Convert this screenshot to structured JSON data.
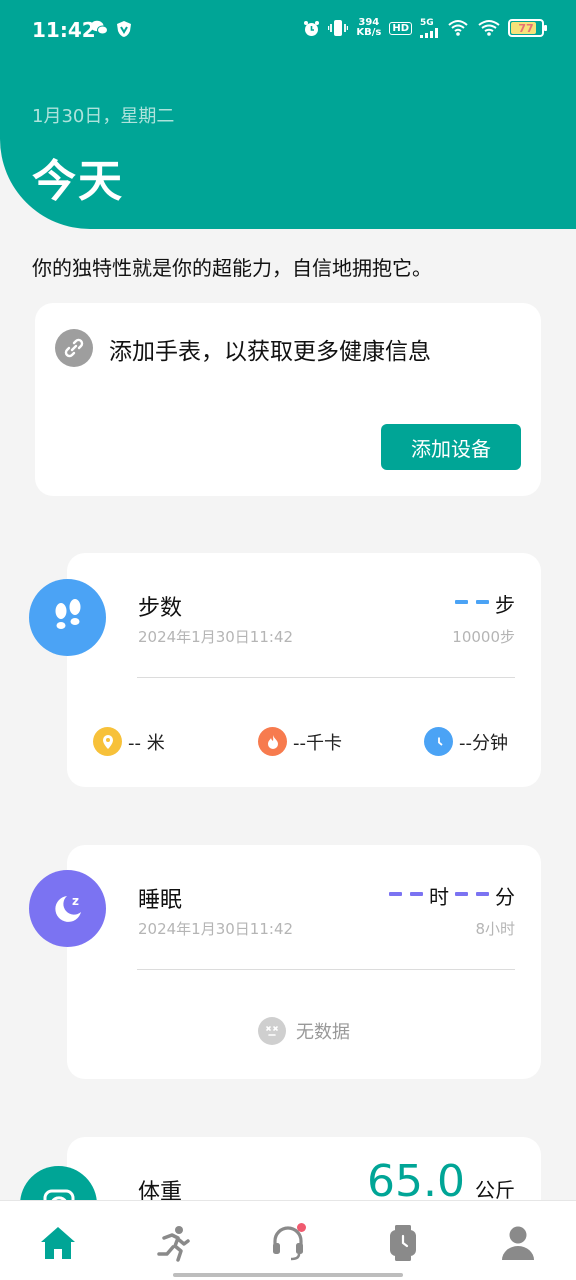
{
  "status_bar": {
    "time": "11:42",
    "net_speed_value": "394",
    "net_speed_unit": "KB/s",
    "hd_label": "HD",
    "signal_label": "5G",
    "battery_level": "77",
    "battery_fill_percent": 77
  },
  "header": {
    "date": "1月30日，星期二",
    "title": "今天"
  },
  "motto": "你的独特性就是你的超能力，自信地拥抱它。",
  "add_device_card": {
    "icon": "link-icon",
    "title": "添加手表，以获取更多健康信息",
    "button_label": "添加设备"
  },
  "steps": {
    "icon": "footprints-icon",
    "title": "步数",
    "timestamp": "2024年1月30日11:42",
    "unit": "步",
    "goal": "10000步",
    "stats": [
      {
        "icon": "location-icon",
        "color": "#f7c13a",
        "label": "-- 米"
      },
      {
        "icon": "flame-icon",
        "color": "#f77b4e",
        "label": "--千卡"
      },
      {
        "icon": "clock-icon",
        "color": "#4ba3f5",
        "label": "--分钟"
      }
    ]
  },
  "sleep": {
    "icon": "moon-icon",
    "title": "睡眠",
    "timestamp": "2024年1月30日11:42",
    "hour_unit": "时",
    "minute_unit": "分",
    "goal": "8小时",
    "no_data": "无数据"
  },
  "weight": {
    "icon": "scale-icon",
    "title": "体重",
    "value": "65.0",
    "unit": "公斤"
  },
  "bottom_nav": [
    {
      "icon": "home-icon",
      "active": true
    },
    {
      "icon": "running-icon",
      "active": false
    },
    {
      "icon": "headset-icon",
      "active": false,
      "badge": true
    },
    {
      "icon": "watch-icon",
      "active": false
    },
    {
      "icon": "profile-icon",
      "active": false
    }
  ],
  "colors": {
    "brand": "#00a596",
    "steps_blue": "#4ba3f5",
    "sleep_purple": "#7b73f2"
  }
}
